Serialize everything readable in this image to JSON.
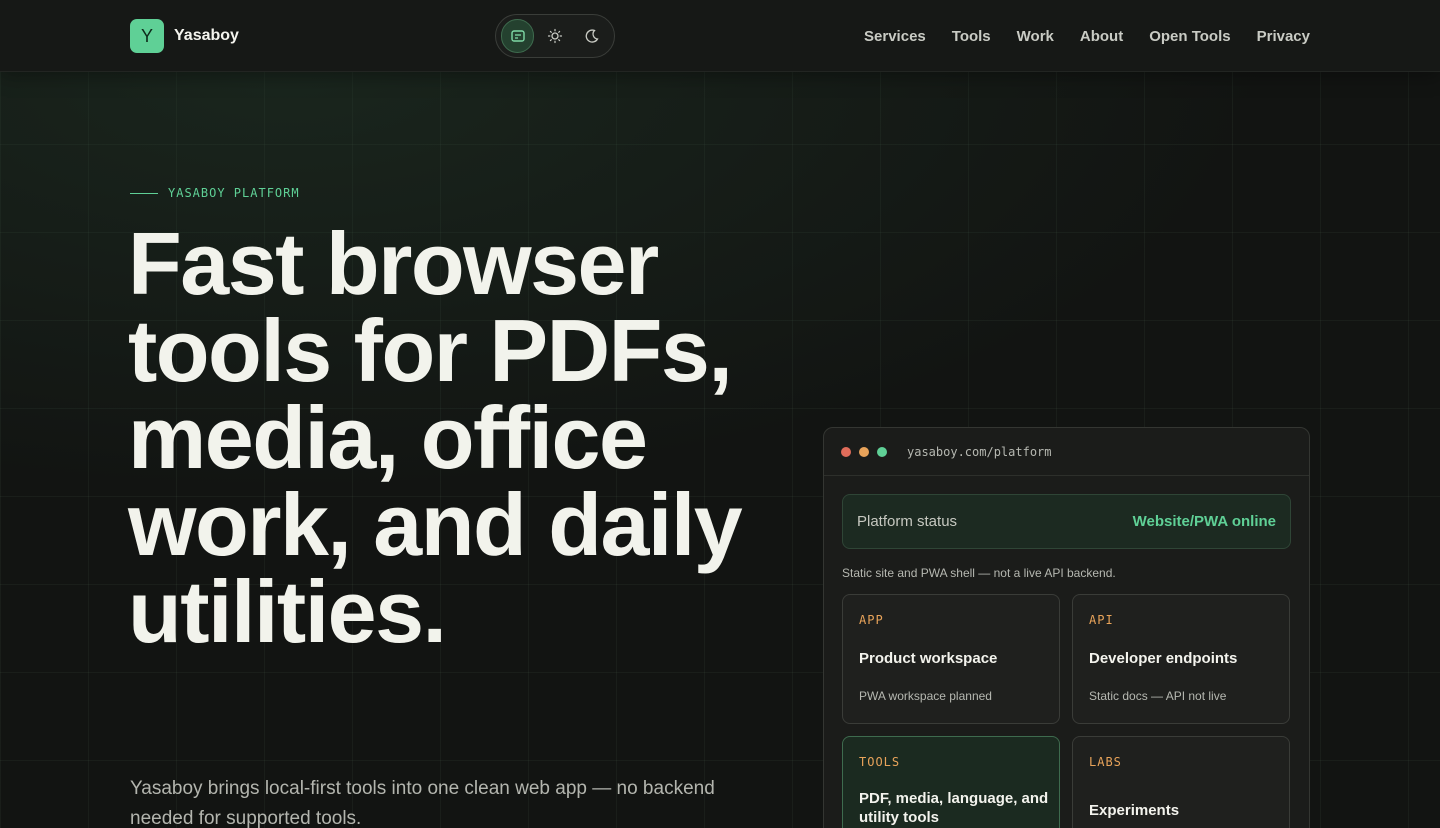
{
  "brand": {
    "logo_letter": "Y",
    "name": "Yasaboy"
  },
  "theme_switch": {
    "options": [
      "system-icon",
      "sun-icon",
      "moon-icon"
    ],
    "active": "system"
  },
  "nav": {
    "items": [
      "Services",
      "Tools",
      "Work",
      "About",
      "Open Tools",
      "Privacy"
    ]
  },
  "hero": {
    "eyebrow": "YASABOY PLATFORM",
    "title": "Fast browser tools for PDFs, media, office work, and daily utilities.",
    "lead": "Yasaboy brings local-first tools into one clean web app — no backend needed for supported tools."
  },
  "window": {
    "url": "yasaboy.com/platform",
    "status_label": "Platform status",
    "status_value": "Website/PWA online",
    "note": "Static site and PWA shell — not a live API backend.",
    "cards": [
      {
        "tag": "APP",
        "title": "Product workspace",
        "sub": "PWA workspace planned"
      },
      {
        "tag": "API",
        "title": "Developer endpoints",
        "sub": "Static docs — API not live"
      },
      {
        "tag": "TOOLS",
        "title": "PDF, media, language, and utility tools",
        "sub": ""
      },
      {
        "tag": "LABS",
        "title": "Experiments",
        "sub": ""
      }
    ]
  },
  "colors": {
    "accent": "#5fd096",
    "tag": "#e8a35a",
    "dot_red": "#e06c5a",
    "dot_yellow": "#e8a35a",
    "dot_green": "#5fd096",
    "background": "#121412"
  }
}
